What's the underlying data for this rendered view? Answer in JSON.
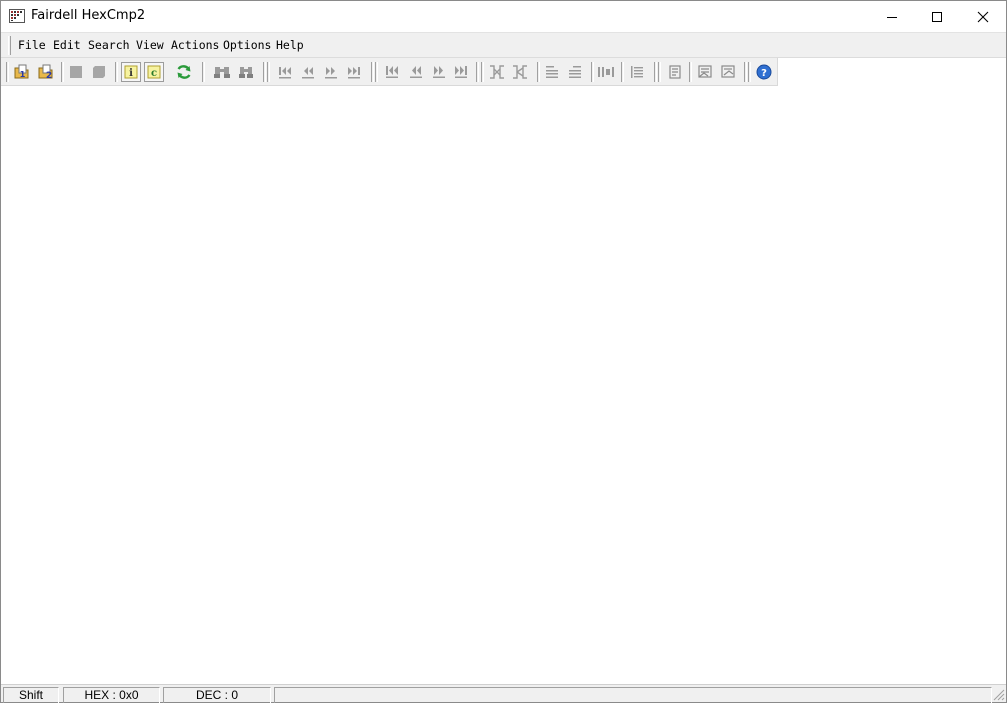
{
  "window": {
    "title": "Fairdell HexCmp2",
    "controls": {
      "minimize_icon": "minimize-icon",
      "maximize_icon": "maximize-icon",
      "close_icon": "close-icon"
    }
  },
  "menubar": {
    "items": [
      {
        "label": "File"
      },
      {
        "label": "Edit"
      },
      {
        "label": "Search"
      },
      {
        "label": "View"
      },
      {
        "label": "Actions"
      },
      {
        "label": "Options"
      },
      {
        "label": "Help"
      }
    ]
  },
  "toolbar": {
    "buttons": [
      {
        "icon": "open-file-1-icon"
      },
      {
        "icon": "open-file-2-icon"
      },
      {
        "icon": "stop-icon"
      },
      {
        "icon": "close-file-icon"
      },
      {
        "icon": "info-icon",
        "glyph": "i",
        "pressed": true
      },
      {
        "icon": "compare-c-icon",
        "glyph": "c",
        "pressed": true
      },
      {
        "icon": "refresh-icon"
      },
      {
        "icon": "find-icon"
      },
      {
        "icon": "find-next-icon"
      },
      {
        "icon": "first-difference-icon"
      },
      {
        "icon": "previous-difference-icon"
      },
      {
        "icon": "next-difference-icon"
      },
      {
        "icon": "last-difference-icon"
      },
      {
        "icon": "first-block-icon"
      },
      {
        "icon": "previous-block-icon"
      },
      {
        "icon": "next-block-icon"
      },
      {
        "icon": "last-block-icon"
      },
      {
        "icon": "sync-left-icon"
      },
      {
        "icon": "sync-right-icon"
      },
      {
        "icon": "align-up-icon"
      },
      {
        "icon": "align-down-icon"
      },
      {
        "icon": "column-view-icon"
      },
      {
        "icon": "list-view-icon"
      },
      {
        "icon": "report-icon"
      },
      {
        "icon": "export-left-icon"
      },
      {
        "icon": "export-right-icon"
      },
      {
        "icon": "help-icon",
        "glyph": "?"
      }
    ],
    "colors": {
      "folder": "#e8b84a",
      "help": "#2f6fd1",
      "refresh": "#2a9a3a",
      "toggle_bg": "#f7f3a0"
    }
  },
  "statusbar": {
    "panels": [
      {
        "label": "Shift"
      },
      {
        "label": "HEX : 0x0"
      },
      {
        "label": "DEC : 0"
      },
      {
        "label": ""
      }
    ]
  }
}
